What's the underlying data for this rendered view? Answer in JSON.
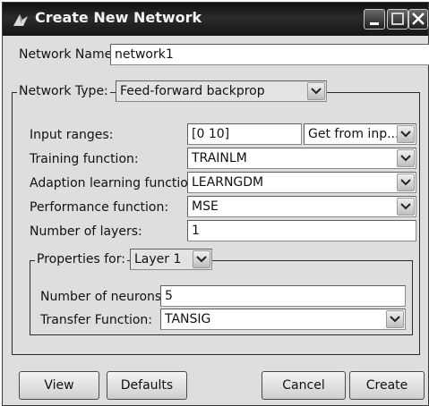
{
  "window": {
    "title": "Create New Network",
    "icon": "matlab-nntool-icon"
  },
  "network_name": {
    "label": "Network Name:",
    "value": "network1"
  },
  "network_type": {
    "label": "Network Type:",
    "value": "Feed-forward backprop"
  },
  "input_ranges": {
    "label": "Input ranges:",
    "value": "[0 10]",
    "source_value": "Get from inp..."
  },
  "training_function": {
    "label": "Training function:",
    "value": "TRAINLM"
  },
  "adaption_function": {
    "label": "Adaption learning function:",
    "value": "LEARNGDM"
  },
  "performance_function": {
    "label": "Performance function:",
    "value": "MSE"
  },
  "number_of_layers": {
    "label": "Number of layers:",
    "value": "1"
  },
  "properties": {
    "label": "Properties for:",
    "layer_value": "Layer 1",
    "neurons_label": "Number of neurons:",
    "neurons_value": "5",
    "transfer_label": "Transfer Function:",
    "transfer_value": "TANSIG"
  },
  "buttons": {
    "view": "View",
    "defaults": "Defaults",
    "cancel": "Cancel",
    "create": "Create"
  }
}
